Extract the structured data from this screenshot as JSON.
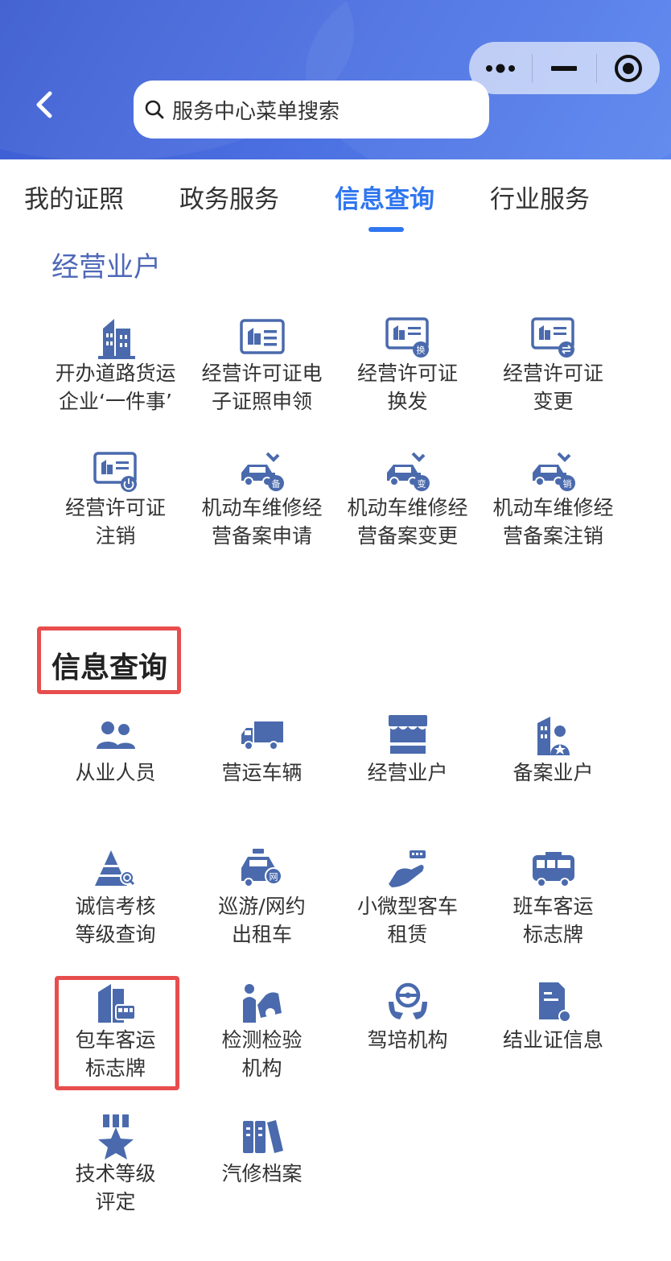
{
  "search": {
    "placeholder": "服务中心菜单搜索"
  },
  "tabs": [
    {
      "label": "我的证照"
    },
    {
      "label": "政务服务"
    },
    {
      "label": "信息查询"
    },
    {
      "label": "行业服务"
    }
  ],
  "active_tab": "信息查询",
  "section1": {
    "title": "经营业户",
    "items": [
      {
        "label": "开办道路货运\n企业‘一件事’",
        "icon": "building-icon"
      },
      {
        "label": "经营许可证电\n子证照申领",
        "icon": "license-card-icon"
      },
      {
        "label": "经营许可证\n换发",
        "icon": "license-exchange-icon"
      },
      {
        "label": "经营许可证\n变更",
        "icon": "license-change-icon"
      },
      {
        "label": "经营许可证\n注销",
        "icon": "license-cancel-icon"
      },
      {
        "label": "机动车维修经\n营备案申请",
        "icon": "car-repair-apply-icon"
      },
      {
        "label": "机动车维修经\n营备案变更",
        "icon": "car-repair-change-icon"
      },
      {
        "label": "机动车维修经\n营备案注销",
        "icon": "car-repair-cancel-icon"
      }
    ]
  },
  "section2": {
    "title": "信息查询",
    "items": [
      {
        "label": "从业人员",
        "icon": "people-icon"
      },
      {
        "label": "营运车辆",
        "icon": "truck-icon"
      },
      {
        "label": "经营业户",
        "icon": "shop-icon"
      },
      {
        "label": "备案业户",
        "icon": "registered-business-icon"
      },
      {
        "label": "诚信考核\n等级查询",
        "icon": "credit-rating-icon"
      },
      {
        "label": "巡游/网约\n出租车",
        "icon": "taxi-icon"
      },
      {
        "label": "小微型客车\n租赁",
        "icon": "car-rental-icon"
      },
      {
        "label": "班车客运\n标志牌",
        "icon": "shuttle-bus-icon"
      },
      {
        "label": "包车客运\n标志牌",
        "icon": "charter-bus-icon"
      },
      {
        "label": "检测检验\n机构",
        "icon": "inspection-icon"
      },
      {
        "label": "驾培机构",
        "icon": "driving-school-icon"
      },
      {
        "label": "结业证信息",
        "icon": "certificate-icon"
      },
      {
        "label": "技术等级\n评定",
        "icon": "medal-icon"
      },
      {
        "label": "汽修档案",
        "icon": "archive-icon"
      }
    ]
  },
  "colors": {
    "header": "#4a6ee0",
    "accent": "#2f76f0",
    "icon": "#4a6aad",
    "highlight": "#e84d4d"
  }
}
